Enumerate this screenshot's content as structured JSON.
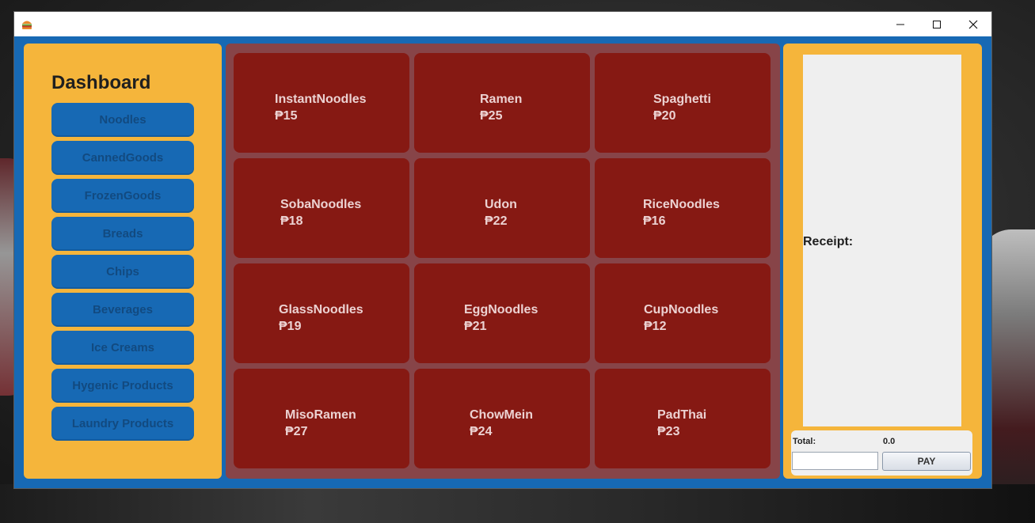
{
  "window": {
    "icon": "burger-icon",
    "controls": [
      "minimize-icon",
      "maximize-icon",
      "close-icon"
    ]
  },
  "sidebar": {
    "title": "Dashboard",
    "categories": [
      {
        "label": "Noodles"
      },
      {
        "label": "CannedGoods"
      },
      {
        "label": "FrozenGoods"
      },
      {
        "label": "Breads"
      },
      {
        "label": "Chips"
      },
      {
        "label": "Beverages"
      },
      {
        "label": "Ice Creams"
      },
      {
        "label": "Hygenic Products"
      },
      {
        "label": "Laundry Products"
      }
    ]
  },
  "products": [
    {
      "name": "InstantNoodles",
      "price": "₱15"
    },
    {
      "name": "Ramen",
      "price": "₱25"
    },
    {
      "name": "Spaghetti",
      "price": "₱20"
    },
    {
      "name": "SobaNoodles",
      "price": "₱18"
    },
    {
      "name": "Udon",
      "price": "₱22"
    },
    {
      "name": "RiceNoodles",
      "price": "₱16"
    },
    {
      "name": "GlassNoodles",
      "price": "₱19"
    },
    {
      "name": "EggNoodles",
      "price": "₱21"
    },
    {
      "name": "CupNoodles",
      "price": "₱12"
    },
    {
      "name": "MisoRamen",
      "price": "₱27"
    },
    {
      "name": "ChowMein",
      "price": "₱24"
    },
    {
      "name": "PadThai",
      "price": "₱23"
    }
  ],
  "receipt": {
    "label": "Receipt:",
    "total_label": "Total:",
    "total_value": "0.0",
    "payment_value": "",
    "pay_label": "PAY"
  },
  "colors": {
    "frame": "#1769b4",
    "panel": "#f5b53b",
    "product_tile": "#861913",
    "grid_bg": "#874448"
  }
}
